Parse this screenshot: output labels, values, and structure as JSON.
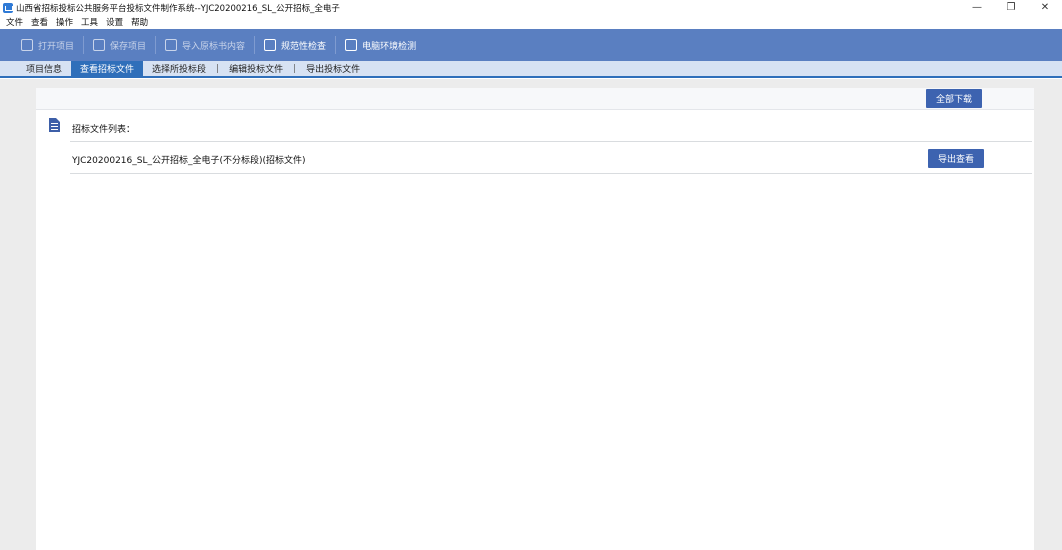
{
  "window": {
    "title": "山西省招标投标公共服务平台投标文件制作系统--YJC20200216_SL_公开招标_全电子",
    "minimize_icon": "—",
    "maximize_icon": "❐",
    "close_icon": "✕"
  },
  "menu": [
    "文件",
    "查看",
    "操作",
    "工具",
    "设置",
    "帮助"
  ],
  "toolbar": {
    "open_project": "打开项目",
    "save_project": "保存项目",
    "import_content": "导入原标书内容",
    "compliance_check": "规范性检查",
    "env_check": "电脑环境检测"
  },
  "tabs": [
    "项目信息",
    "查看招标文件",
    "选择所投标段",
    "编辑投标文件",
    "导出投标文件"
  ],
  "tab_separator": "|",
  "main": {
    "download_all": "全部下载",
    "list_label": "招标文件列表：",
    "file_name": "YJC20200216_SL_公开招标_全电子(不分标段)(招标文件)",
    "export_view": "导出查看"
  }
}
